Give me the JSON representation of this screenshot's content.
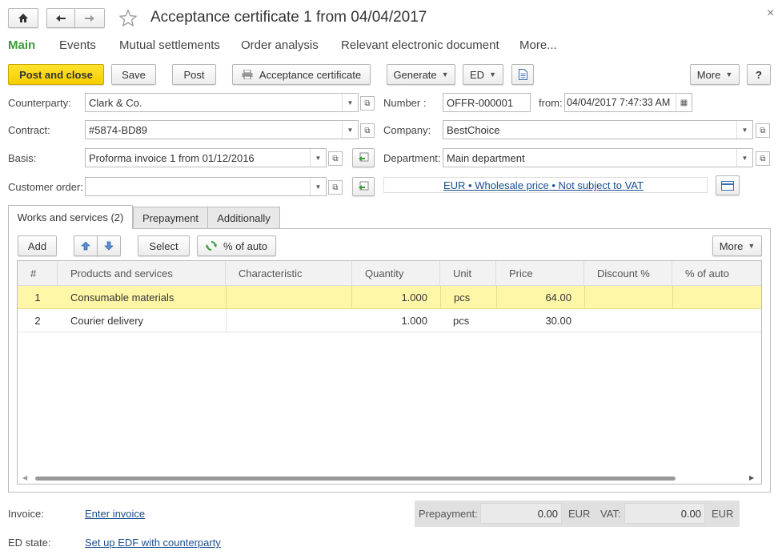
{
  "window": {
    "title": "Acceptance certificate 1 from 04/04/2017",
    "close_glyph": "×"
  },
  "nav_tabs": [
    "Main",
    "Events",
    "Mutual settlements",
    "Order analysis",
    "Relevant electronic document",
    "More..."
  ],
  "toolbar": {
    "post_close": "Post and close",
    "save": "Save",
    "post": "Post",
    "acceptance_certificate": "Acceptance certificate",
    "generate": "Generate",
    "ed": "ED",
    "more": "More",
    "help": "?"
  },
  "form": {
    "counterparty_label": "Counterparty:",
    "counterparty": "Clark & Co.",
    "contract_label": "Contract:",
    "contract": "#5874-BD89",
    "basis_label": "Basis:",
    "basis": "Proforma invoice 1 from 01/12/2016",
    "customer_order_label": "Customer order:",
    "customer_order": "",
    "number_label": "Number :",
    "number": "OFFR-000001",
    "from_label": "from:",
    "date": "04/04/2017  7:47:33 AM",
    "company_label": "Company:",
    "company": "BestChoice",
    "department_label": "Department:",
    "department": "Main department",
    "price_terms": "EUR • Wholesale price • Not subject to VAT"
  },
  "inner_tabs": [
    "Works and services (2)",
    "Prepayment",
    "Additionally"
  ],
  "table_toolbar": {
    "add": "Add",
    "select": "Select",
    "auto": "% of auto",
    "more": "More"
  },
  "table": {
    "columns": [
      "#",
      "Products and services",
      "Characteristic",
      "Quantity",
      "Unit",
      "Price",
      "Discount %",
      "% of auto"
    ],
    "rows": [
      {
        "n": "1",
        "product": "Consumable materials",
        "characteristic": "",
        "quantity": "1.000",
        "unit": "pcs",
        "price": "64.00",
        "discount": "",
        "auto": ""
      },
      {
        "n": "2",
        "product": "Courier delivery",
        "characteristic": "",
        "quantity": "1.000",
        "unit": "pcs",
        "price": "30.00",
        "discount": "",
        "auto": ""
      }
    ]
  },
  "footer": {
    "invoice_label": "Invoice:",
    "invoice_link": "Enter invoice",
    "ed_state_label": "ED state:",
    "ed_state_link": "Set up EDF with counterparty",
    "prepayment_label": "Prepayment:",
    "prepayment_value": "0.00",
    "prepayment_currency": "EUR",
    "vat_label": "VAT:",
    "vat_value": "0.00",
    "vat_currency": "EUR"
  },
  "colors": {
    "accent_green": "#3a9a3a",
    "highlight_row": "#fff7a8",
    "yellow_button": "#f6cd00",
    "link": "#1a4d8f"
  }
}
